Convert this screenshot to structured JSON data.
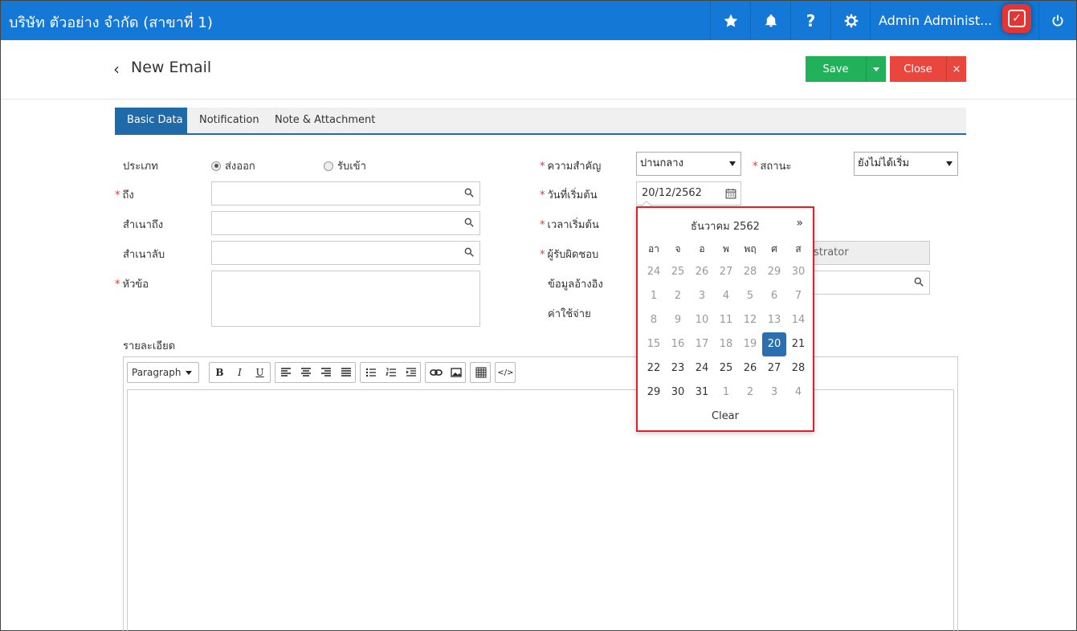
{
  "topbar": {
    "company": "บริษัท ตัวอย่าง จำกัด (สาขาที่ 1)",
    "user_name": "Admin Administ...",
    "accent": "#1479d6"
  },
  "header": {
    "back_icon": "‹",
    "title": "New Email",
    "save_label": "Save",
    "close_label": "Close",
    "close_x": "×"
  },
  "tabs": [
    {
      "label": "Basic Data",
      "active": true
    },
    {
      "label": "Notification",
      "active": false
    },
    {
      "label": "Note & Attachment",
      "active": false
    }
  ],
  "form": {
    "type_label": "ประเภท",
    "type_option_out": "ส่งออก",
    "type_option_in": "รับเข้า",
    "to_label": "ถึง",
    "cc_label": "สำเนาถึง",
    "bcc_label": "สำเนาลับ",
    "subject_label": "หัวข้อ",
    "priority_label": "ความสำคัญ",
    "priority_value": "ปานกลาง",
    "status_label": "สถานะ",
    "status_value": "ยังไม่ได้เริ่ม",
    "start_date_label": "วันที่เริ่มต้น",
    "start_date_value": "20/12/2562",
    "start_time_label": "เวลาเริ่มต้น",
    "responsible_label": "ผู้รับผิดชอบ",
    "responsible_value": "strator",
    "reference_label": "ข้อมูลอ้างอิง",
    "expense_label": "ค่าใช้จ่าย",
    "detail_label": "รายละเอียด"
  },
  "editor": {
    "paragraph": "Paragraph",
    "bold": "B",
    "italic": "I",
    "underline": "U",
    "code": "</>"
  },
  "datepicker": {
    "month_title": "ธันวาคม 2562",
    "next": "»",
    "weekdays": [
      "อา",
      "จ",
      "อ",
      "พ",
      "พฤ",
      "ศ",
      "ส"
    ],
    "weeks": [
      [
        {
          "d": "24",
          "m": 1
        },
        {
          "d": "25",
          "m": 1
        },
        {
          "d": "26",
          "m": 1
        },
        {
          "d": "27",
          "m": 1
        },
        {
          "d": "28",
          "m": 1
        },
        {
          "d": "29",
          "m": 1
        },
        {
          "d": "30",
          "m": 1
        }
      ],
      [
        {
          "d": "1",
          "m": 1
        },
        {
          "d": "2",
          "m": 1
        },
        {
          "d": "3",
          "m": 1
        },
        {
          "d": "4",
          "m": 1
        },
        {
          "d": "5",
          "m": 1
        },
        {
          "d": "6",
          "m": 1
        },
        {
          "d": "7",
          "m": 1
        }
      ],
      [
        {
          "d": "8",
          "m": 1
        },
        {
          "d": "9",
          "m": 1
        },
        {
          "d": "10",
          "m": 1
        },
        {
          "d": "11",
          "m": 1
        },
        {
          "d": "12",
          "m": 1
        },
        {
          "d": "13",
          "m": 1
        },
        {
          "d": "14",
          "m": 1
        }
      ],
      [
        {
          "d": "15",
          "m": 1
        },
        {
          "d": "16",
          "m": 1
        },
        {
          "d": "17",
          "m": 1
        },
        {
          "d": "18",
          "m": 1
        },
        {
          "d": "19",
          "m": 1
        },
        {
          "d": "20",
          "m": 0,
          "s": 1
        },
        {
          "d": "21",
          "m": 0
        }
      ],
      [
        {
          "d": "22",
          "m": 0
        },
        {
          "d": "23",
          "m": 0
        },
        {
          "d": "24",
          "m": 0
        },
        {
          "d": "25",
          "m": 0
        },
        {
          "d": "26",
          "m": 0
        },
        {
          "d": "27",
          "m": 0
        },
        {
          "d": "28",
          "m": 0
        }
      ],
      [
        {
          "d": "29",
          "m": 0
        },
        {
          "d": "30",
          "m": 0
        },
        {
          "d": "31",
          "m": 0
        },
        {
          "d": "1",
          "m": 1
        },
        {
          "d": "2",
          "m": 1
        },
        {
          "d": "3",
          "m": 1
        },
        {
          "d": "4",
          "m": 1
        }
      ]
    ],
    "clear": "Clear"
  }
}
